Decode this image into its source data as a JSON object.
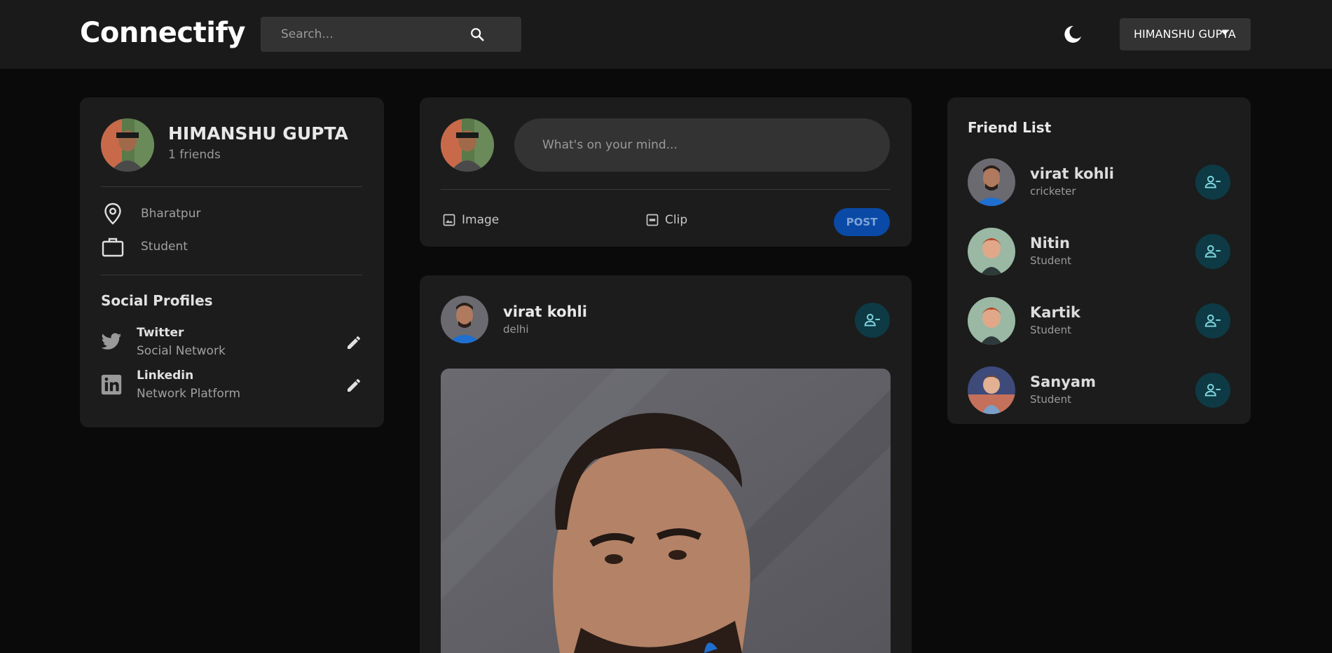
{
  "header": {
    "brand": "Connectify",
    "search_placeholder": "Search...",
    "user_select_value": "HIMANSHU GUPTA"
  },
  "profile": {
    "name": "HIMANSHU GUPTA",
    "friends_count": "1 friends",
    "location": "Bharatpur",
    "occupation": "Student",
    "social_title": "Social Profiles",
    "socials": [
      {
        "name": "Twitter",
        "type": "Social Network"
      },
      {
        "name": "Linkedin",
        "type": "Network Platform"
      }
    ]
  },
  "composer": {
    "placeholder": "What's on your mind...",
    "image_label": "Image",
    "clip_label": "Clip",
    "post_label": "POST"
  },
  "post": {
    "author": "virat kohli",
    "location": "delhi"
  },
  "friend_list": {
    "title": "Friend List",
    "friends": [
      {
        "name": "virat kohli",
        "occupation": "cricketer"
      },
      {
        "name": "Nitin",
        "occupation": "Student"
      },
      {
        "name": "Kartik",
        "occupation": "Student"
      },
      {
        "name": "Sanyam",
        "occupation": "Student"
      }
    ]
  },
  "colors": {
    "background": "#0a0a0a",
    "card": "#1c1c1c",
    "navbar": "#1a1a1a",
    "accent_button": "#0a4aa6",
    "friend_button": "#0d3a44",
    "friend_icon": "#7fd6e0"
  },
  "icons": [
    "search-icon",
    "moon-icon",
    "location-icon",
    "briefcase-icon",
    "twitter-icon",
    "linkedin-icon",
    "edit-icon",
    "image-icon",
    "gif-icon",
    "remove-friend-icon"
  ]
}
